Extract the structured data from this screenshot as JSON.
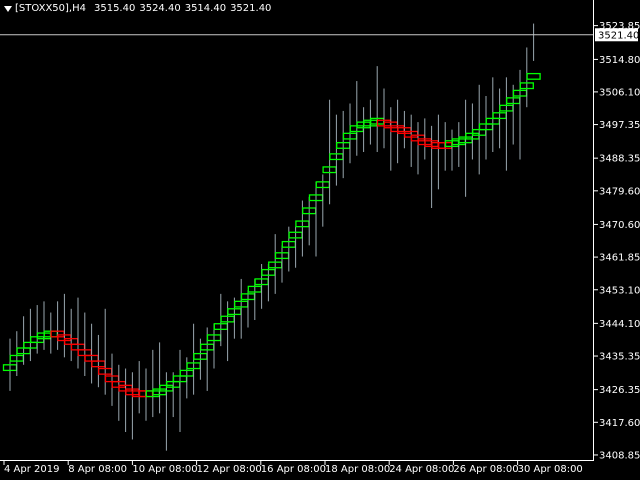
{
  "header": {
    "symbol": "[STOXX50],H4",
    "open": "3515.40",
    "high": "3524.40",
    "low": "3514.40",
    "close": "3521.40"
  },
  "colors": {
    "background": "#000000",
    "bull": "#00ff00",
    "bear": "#ff0000",
    "wick": "#9aa8b0",
    "axis": "#ffffff",
    "price_line": "#c8c8c8"
  },
  "chart_data": {
    "type": "candlestick",
    "title": "",
    "xlabel": "",
    "ylabel": "",
    "ylim": [
      3407.5,
      3527.5
    ],
    "y_ticks": [
      "3523.85",
      "3514.80",
      "3506.10",
      "3497.35",
      "3488.35",
      "3479.60",
      "3470.60",
      "3461.85",
      "3453.10",
      "3444.10",
      "3435.35",
      "3426.35",
      "3417.60",
      "3408.85"
    ],
    "x_ticks": [
      "4 Apr 2019",
      "8 Apr 08:00",
      "10 Apr 08:00",
      "12 Apr 08:00",
      "16 Apr 08:00",
      "18 Apr 08:00",
      "24 Apr 08:00",
      "26 Apr 08:00",
      "30 Apr 08:00"
    ],
    "current_price": "3521.40",
    "grid": false,
    "note_bars": "each bar: body_low, body_high (smoothed bar body), wick_low, wick_high, trend (up/down)",
    "bars": [
      [
        3431.5,
        3433.0,
        3426.0,
        3440.0,
        "up"
      ],
      [
        3434.0,
        3435.5,
        3430.0,
        3442.0,
        "up"
      ],
      [
        3436.0,
        3437.5,
        3433.0,
        3446.0,
        "up"
      ],
      [
        3437.5,
        3439.0,
        3434.0,
        3448.0,
        "up"
      ],
      [
        3439.0,
        3440.5,
        3436.0,
        3449.0,
        "up"
      ],
      [
        3440.0,
        3441.5,
        3437.0,
        3450.0,
        "up"
      ],
      [
        3440.5,
        3442.0,
        3436.0,
        3447.0,
        "up"
      ],
      [
        3440.5,
        3442.0,
        3437.0,
        3450.0,
        "down"
      ],
      [
        3439.5,
        3441.0,
        3435.0,
        3452.0,
        "down"
      ],
      [
        3438.5,
        3440.0,
        3434.0,
        3448.0,
        "down"
      ],
      [
        3437.0,
        3438.5,
        3432.0,
        3451.0,
        "down"
      ],
      [
        3435.5,
        3437.0,
        3430.0,
        3447.0,
        "down"
      ],
      [
        3434.0,
        3435.5,
        3428.0,
        3444.0,
        "down"
      ],
      [
        3432.5,
        3434.0,
        3427.0,
        3441.0,
        "down"
      ],
      [
        3430.5,
        3432.0,
        3425.0,
        3448.0,
        "down"
      ],
      [
        3428.5,
        3430.0,
        3422.0,
        3436.0,
        "down"
      ],
      [
        3427.0,
        3428.5,
        3418.0,
        3433.0,
        "down"
      ],
      [
        3426.0,
        3427.5,
        3415.0,
        3432.0,
        "down"
      ],
      [
        3425.0,
        3426.5,
        3413.0,
        3431.0,
        "down"
      ],
      [
        3424.5,
        3426.0,
        3420.0,
        3434.0,
        "down"
      ],
      [
        3424.5,
        3426.0,
        3418.0,
        3432.0,
        "down"
      ],
      [
        3424.5,
        3426.0,
        3419.0,
        3437.0,
        "up"
      ],
      [
        3425.0,
        3426.5,
        3420.0,
        3439.0,
        "up"
      ],
      [
        3426.0,
        3427.5,
        3410.0,
        3431.0,
        "up"
      ],
      [
        3427.0,
        3428.5,
        3419.0,
        3431.0,
        "up"
      ],
      [
        3428.5,
        3430.0,
        3415.0,
        3437.0,
        "up"
      ],
      [
        3430.0,
        3431.5,
        3424.0,
        3435.0,
        "up"
      ],
      [
        3432.0,
        3433.5,
        3425.0,
        3444.0,
        "up"
      ],
      [
        3434.5,
        3436.0,
        3429.0,
        3440.0,
        "up"
      ],
      [
        3437.0,
        3438.5,
        3426.0,
        3443.0,
        "up"
      ],
      [
        3439.5,
        3441.0,
        3432.0,
        3444.0,
        "up"
      ],
      [
        3442.5,
        3444.0,
        3438.0,
        3452.0,
        "up"
      ],
      [
        3444.5,
        3446.0,
        3434.0,
        3450.0,
        "up"
      ],
      [
        3446.5,
        3448.0,
        3440.0,
        3451.0,
        "up"
      ],
      [
        3448.5,
        3450.0,
        3440.0,
        3456.0,
        "up"
      ],
      [
        3450.5,
        3452.0,
        3443.0,
        3453.0,
        "up"
      ],
      [
        3452.5,
        3454.0,
        3445.0,
        3456.0,
        "up"
      ],
      [
        3454.5,
        3456.0,
        3448.0,
        3460.0,
        "up"
      ],
      [
        3457.0,
        3458.5,
        3450.0,
        3460.0,
        "up"
      ],
      [
        3459.0,
        3460.5,
        3452.0,
        3468.0,
        "up"
      ],
      [
        3461.5,
        3463.0,
        3455.0,
        3465.0,
        "up"
      ],
      [
        3464.5,
        3466.0,
        3458.0,
        3470.0,
        "up"
      ],
      [
        3467.0,
        3468.5,
        3459.0,
        3470.0,
        "up"
      ],
      [
        3470.0,
        3471.5,
        3462.0,
        3477.0,
        "up"
      ],
      [
        3473.5,
        3475.0,
        3465.0,
        3478.0,
        "up"
      ],
      [
        3477.0,
        3478.5,
        3462.0,
        3482.0,
        "up"
      ],
      [
        3480.5,
        3482.0,
        3470.0,
        3484.0,
        "up"
      ],
      [
        3484.5,
        3486.0,
        3476.0,
        3504.0,
        "up"
      ],
      [
        3488.0,
        3489.5,
        3481.0,
        3500.0,
        "up"
      ],
      [
        3491.0,
        3492.5,
        3483.0,
        3501.0,
        "up"
      ],
      [
        3493.5,
        3495.0,
        3487.0,
        3503.0,
        "up"
      ],
      [
        3495.5,
        3497.0,
        3489.0,
        3509.0,
        "up"
      ],
      [
        3496.5,
        3498.0,
        3490.0,
        3502.0,
        "up"
      ],
      [
        3497.0,
        3498.5,
        3492.0,
        3504.0,
        "up"
      ],
      [
        3497.5,
        3499.0,
        3490.0,
        3513.0,
        "up"
      ],
      [
        3497.0,
        3498.5,
        3491.0,
        3507.0,
        "down"
      ],
      [
        3496.5,
        3498.0,
        3485.0,
        3502.0,
        "down"
      ],
      [
        3495.5,
        3497.0,
        3487.0,
        3504.0,
        "down"
      ],
      [
        3495.0,
        3496.5,
        3491.0,
        3501.0,
        "down"
      ],
      [
        3494.0,
        3495.5,
        3486.0,
        3500.0,
        "down"
      ],
      [
        3493.0,
        3494.5,
        3484.0,
        3498.0,
        "down"
      ],
      [
        3492.0,
        3493.5,
        3488.0,
        3499.0,
        "down"
      ],
      [
        3491.5,
        3493.0,
        3475.0,
        3497.0,
        "down"
      ],
      [
        3491.0,
        3492.5,
        3480.0,
        3500.0,
        "down"
      ],
      [
        3491.0,
        3492.5,
        3485.0,
        3498.0,
        "down"
      ],
      [
        3491.5,
        3493.0,
        3485.0,
        3496.0,
        "up"
      ],
      [
        3492.0,
        3493.5,
        3486.0,
        3498.0,
        "up"
      ],
      [
        3492.5,
        3494.0,
        3478.0,
        3504.0,
        "up"
      ],
      [
        3493.5,
        3495.0,
        3488.0,
        3503.0,
        "up"
      ],
      [
        3494.5,
        3496.0,
        3484.0,
        3508.0,
        "up"
      ],
      [
        3496.0,
        3497.5,
        3488.0,
        3505.0,
        "up"
      ],
      [
        3497.5,
        3499.0,
        3490.0,
        3510.0,
        "up"
      ],
      [
        3499.0,
        3500.5,
        3491.0,
        3507.0,
        "up"
      ],
      [
        3501.0,
        3502.5,
        3485.0,
        3510.0,
        "up"
      ],
      [
        3503.0,
        3504.5,
        3492.0,
        3508.0,
        "up"
      ],
      [
        3505.0,
        3506.5,
        3488.0,
        3512.0,
        "up"
      ],
      [
        3507.0,
        3508.5,
        3502.0,
        3518.0,
        "up"
      ],
      [
        3509.5,
        3511.0,
        3514.4,
        3524.4,
        "up"
      ]
    ]
  }
}
